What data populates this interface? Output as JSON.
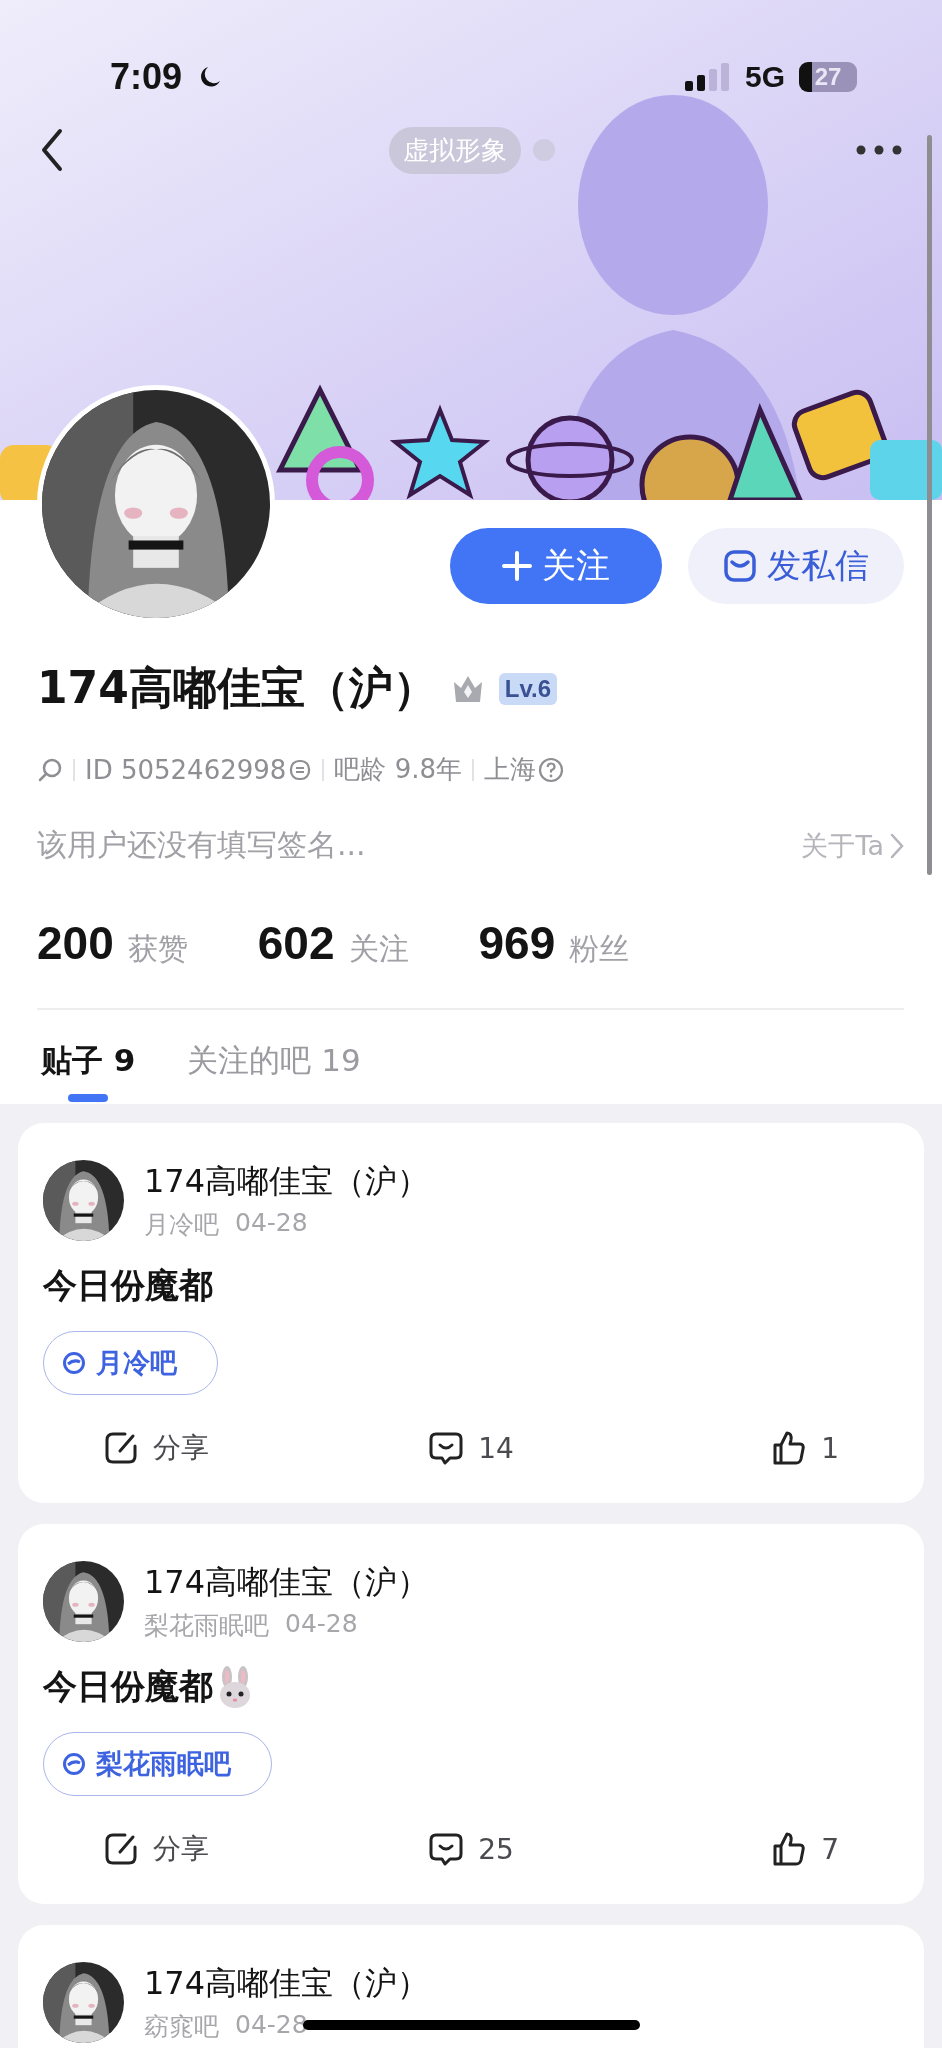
{
  "status_bar": {
    "time": "7:09",
    "network": "5G",
    "battery": "27"
  },
  "nav": {
    "avatar_label": "虚拟形象"
  },
  "actions": [
    {
      "kind": "follow",
      "label": "关注"
    },
    {
      "kind": "message",
      "label": "发私信"
    }
  ],
  "profile": {
    "name": "174高嘟佳宝（沪）",
    "level": "Lv.6",
    "id": "ID 5052462998",
    "age": "吧龄 9.8年",
    "location": "上海",
    "signature": "该用户还没有填写签名...",
    "about": "关于Ta"
  },
  "stats": [
    {
      "value": "200",
      "label": "获赞"
    },
    {
      "value": "602",
      "label": "关注"
    },
    {
      "value": "969",
      "label": "粉丝"
    }
  ],
  "tabs": [
    {
      "label": "贴子",
      "count": "9",
      "selected": true
    },
    {
      "label": "关注的吧",
      "count": "19",
      "selected": false
    }
  ],
  "posts": [
    {
      "author": "174高嘟佳宝（沪）",
      "forum": "月冷吧",
      "date": "04-28",
      "title": "今日份魔都",
      "emoji": false,
      "forum_tag": "月冷吧",
      "share": "分享",
      "comments": "14",
      "likes": "1"
    },
    {
      "author": "174高嘟佳宝（沪）",
      "forum": "梨花雨眠吧",
      "date": "04-28",
      "title": "今日份魔都",
      "emoji": true,
      "forum_tag": "梨花雨眠吧",
      "share": "分享",
      "comments": "25",
      "likes": "7"
    },
    {
      "author": "174高嘟佳宝（沪）",
      "forum": "窈窕吧",
      "date": "04-28"
    }
  ]
}
